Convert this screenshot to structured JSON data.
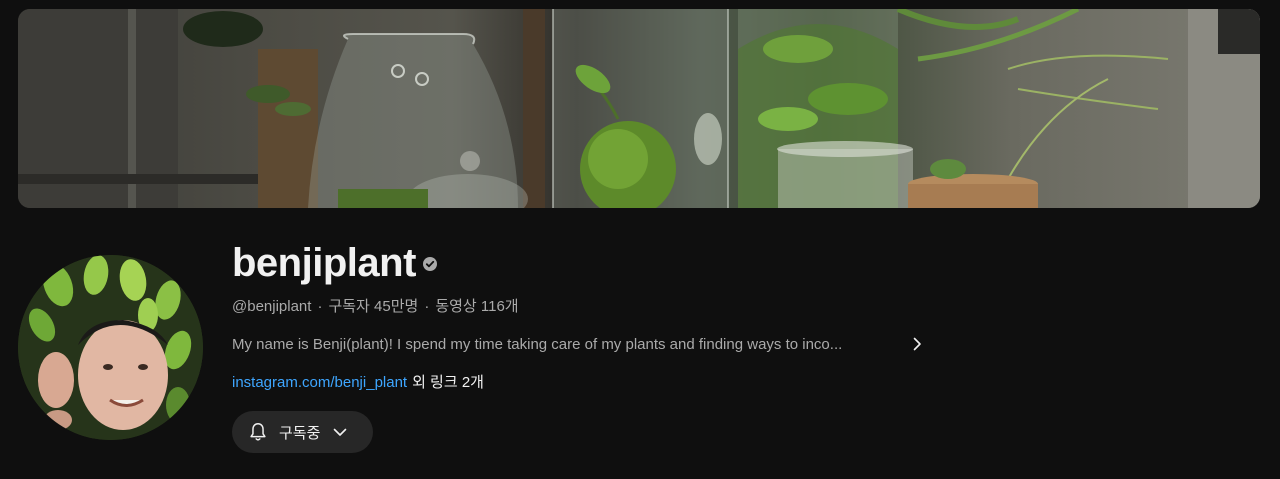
{
  "channel": {
    "name": "benjiplant",
    "handle": "@benjiplant",
    "separator": "·",
    "subscribers": "구독자 45만명",
    "videos": "동영상 116개",
    "description": "My name is Benji(plant)! I spend my time taking care of my plants and finding ways to inco...",
    "link_text": "instagram.com/benji_plant",
    "more_links": "외 링크 2개"
  },
  "subscribe_button": {
    "label": "구독중"
  },
  "colors": {
    "background": "#0f0f0f",
    "text_primary": "#f1f1f1",
    "text_secondary": "#aaaaaa",
    "link": "#3ea6ff",
    "button_bg": "#272727"
  },
  "icons": {
    "verified": "verified-check-icon",
    "description_expand": "chevron-right-icon",
    "notification": "bell-icon",
    "dropdown": "chevron-down-icon"
  }
}
